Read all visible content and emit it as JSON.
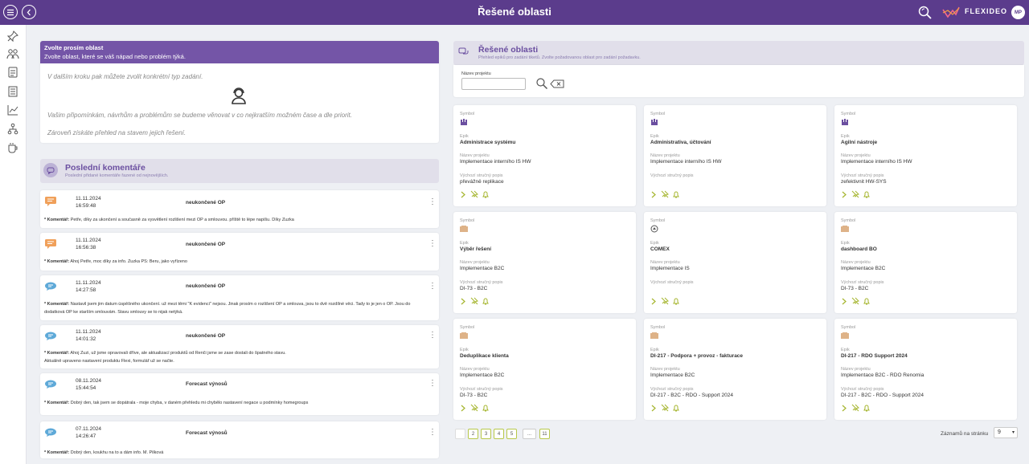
{
  "header": {
    "title": "Řešené oblasti",
    "brand": "FLEXIDEO",
    "avatar": "MP"
  },
  "colors": {
    "primary": "#5b3c8c",
    "accent": "#b8c84a",
    "icon_orange": "#f0a05a",
    "icon_blue": "#5ea9d8"
  },
  "sidebar": {
    "items": [
      {
        "icon": "pin-icon"
      },
      {
        "icon": "people-icon"
      },
      {
        "icon": "document-icon"
      },
      {
        "icon": "list-icon"
      },
      {
        "icon": "chart-icon"
      },
      {
        "icon": "hierarchy-icon"
      },
      {
        "icon": "coffee-icon"
      }
    ]
  },
  "intro": {
    "title": "Zvolte prosím oblast",
    "subtitle": "Zvolte oblast, které se váš nápad nebo problém týká.",
    "line1": "V dalším kroku pak můžete zvolit konkrétní typ zadání.",
    "line2": "Vašim připomínkám, návrhům a problémům se budeme věnovat v co nejkratším možném čase a dle priorit.",
    "line3": "Zároveň získáte přehled na stavem jejich řešení."
  },
  "comments": {
    "title": "Poslední komentáře",
    "subtitle": "Poslední přidané komentáře řazené od nejnovějších.",
    "label": "* Komentář:",
    "items": [
      {
        "date": "11.11.2024",
        "time": "16:59:48",
        "subject": "neukončené OP",
        "text": "Petře, díky za ukončení a současně za vysvětlení rozlišení mezi OP a smlouvou. příště to lépe napíšu. Díky Zuzka"
      },
      {
        "date": "11.11.2024",
        "time": "16:56:38",
        "subject": "neukončené OP",
        "text": "Ahoj Petře, moc díky za info. Zuzka PS: Beru, jako vyřízeno"
      },
      {
        "date": "11.11.2024",
        "time": "14:27:58",
        "subject": "neukončené OP",
        "text": "Nastavil jsem jim datum úspěšného ukončení. už mezi těmi \"K evidenci\" nejsou. Jinak prosím o rozlišení OP a smlouva, jsou to dvě rozdílné věci. Tady to je jen o OP. Jsou do",
        "text2": "dodatková OP ke starším smlouvám. Stavu smlouvy se to nijak netýká."
      },
      {
        "date": "11.11.2024",
        "time": "14:01:32",
        "subject": "neukončené OP",
        "text": "Ahoj Zuzi, už jsme opravovali dříve, ale aktualizací produktů od Renči jsme se zase dostali do špatného stavu.",
        "text2": "Aktuálně upraveno nastavení produktu Flexi, formulář už se načte."
      },
      {
        "date": "08.11.2024",
        "time": "15:44:54",
        "subject": "Forecast výnosů",
        "text": "Dobrý den, tak jsem se dopátrala - moje chyba, v daném přehledu mi chybělo nastavení negace u podmínky homegroups"
      },
      {
        "date": "07.11.2024",
        "time": "14:26:47",
        "subject": "Forecast výnosů",
        "text": "Dobrý den, koukhu na to a dám info. M. Pilková"
      }
    ]
  },
  "areas": {
    "title": "Řešené oblasti",
    "subtitle": "Přehled epiků pro zadání tiketů. Zvolte požadovanou oblast pro zadání požadavku.",
    "search_label": "Název projektu",
    "search_value": "",
    "labels": {
      "symbol": "Symbol",
      "epic": "Epik",
      "project": "Název projektu",
      "desc": "Výchozí stručný popis"
    },
    "cards": [
      {
        "epic": "Administrace systému",
        "project": "Implementace interního IS HW",
        "desc": "převážně replikace",
        "symbol": "crown-icon"
      },
      {
        "epic": "Administrativa, účtování",
        "project": "Implementace interního IS HW",
        "desc": "",
        "symbol": "crown-icon"
      },
      {
        "epic": "Agilní nástroje",
        "project": "Implementace interního IS HW",
        "desc": "zefektivnit HW-SYS",
        "symbol": "crown-icon"
      },
      {
        "epic": "Výběr řešení",
        "project": "Implementace B2C",
        "desc": "DI-73 - B2C",
        "symbol": "bars-icon"
      },
      {
        "epic": "COMEX",
        "project": "Implementace IS",
        "desc": "",
        "symbol": "badge-icon"
      },
      {
        "epic": "dashboard BO",
        "project": "Implementace B2C",
        "desc": "DI-73 - B2C",
        "symbol": "bars-icon"
      },
      {
        "epic": "Deduplikace klienta",
        "project": "Implementace B2C",
        "desc": "DI-73 - B2C",
        "symbol": "bars-icon"
      },
      {
        "epic": "DI-217 - Podpora + provoz - fakturace",
        "project": "Implementace B2C",
        "desc": "DI-217 - B2C - RDO - Support 2024",
        "symbol": "bars-icon"
      },
      {
        "epic": "DI-217 - RDO Support 2024",
        "project": "Implementace B2C - RDO Renomia",
        "desc": "DI-217 - B2C - RDO - Support 2024",
        "symbol": "bars-icon"
      }
    ],
    "pager": {
      "pages": [
        "2",
        "3",
        "4",
        "5",
        "...",
        "11"
      ],
      "per_page_label": "Záznamů na stránku",
      "per_page": "9"
    }
  }
}
